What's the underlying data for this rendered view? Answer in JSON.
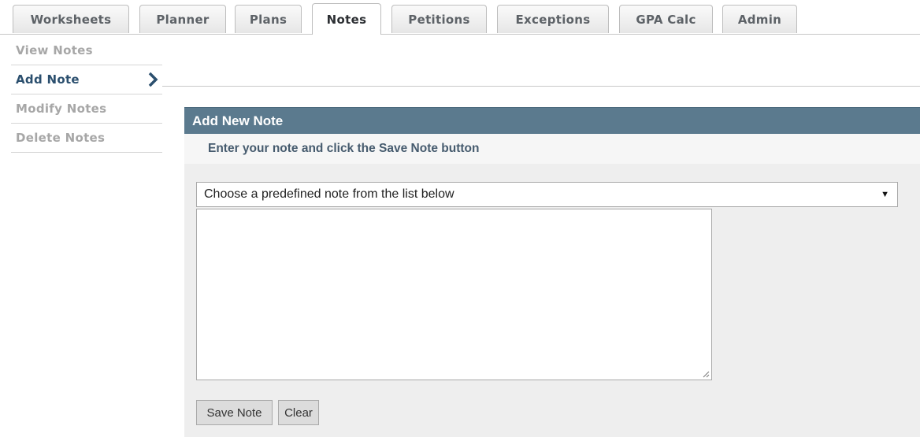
{
  "tabs": [
    {
      "label": "Worksheets"
    },
    {
      "label": "Planner"
    },
    {
      "label": "Plans"
    },
    {
      "label": "Notes",
      "active": true
    },
    {
      "label": "Petitions"
    },
    {
      "label": "Exceptions"
    },
    {
      "label": "GPA Calc"
    },
    {
      "label": "Admin"
    }
  ],
  "sidebar": {
    "items": [
      {
        "label": "View Notes"
      },
      {
        "label": "Add Note",
        "active": true
      },
      {
        "label": "Modify Notes"
      },
      {
        "label": "Delete Notes"
      }
    ]
  },
  "panel": {
    "title": "Add New Note",
    "instruction": "Enter your note and click the Save Note button",
    "predefined_select": {
      "selected": "Choose a predefined note from the list below"
    },
    "note_text": "",
    "buttons": {
      "save": "Save Note",
      "clear": "Clear"
    }
  },
  "colors": {
    "header_bg": "#5b7a8e",
    "active_nav": "#2b4f6e",
    "panel_bg": "#eeeeee"
  },
  "icons": {
    "active_indicator": "chevron-right-icon",
    "select_arrow": "caret-down-icon",
    "textarea_resize": "resize-handle-icon"
  }
}
